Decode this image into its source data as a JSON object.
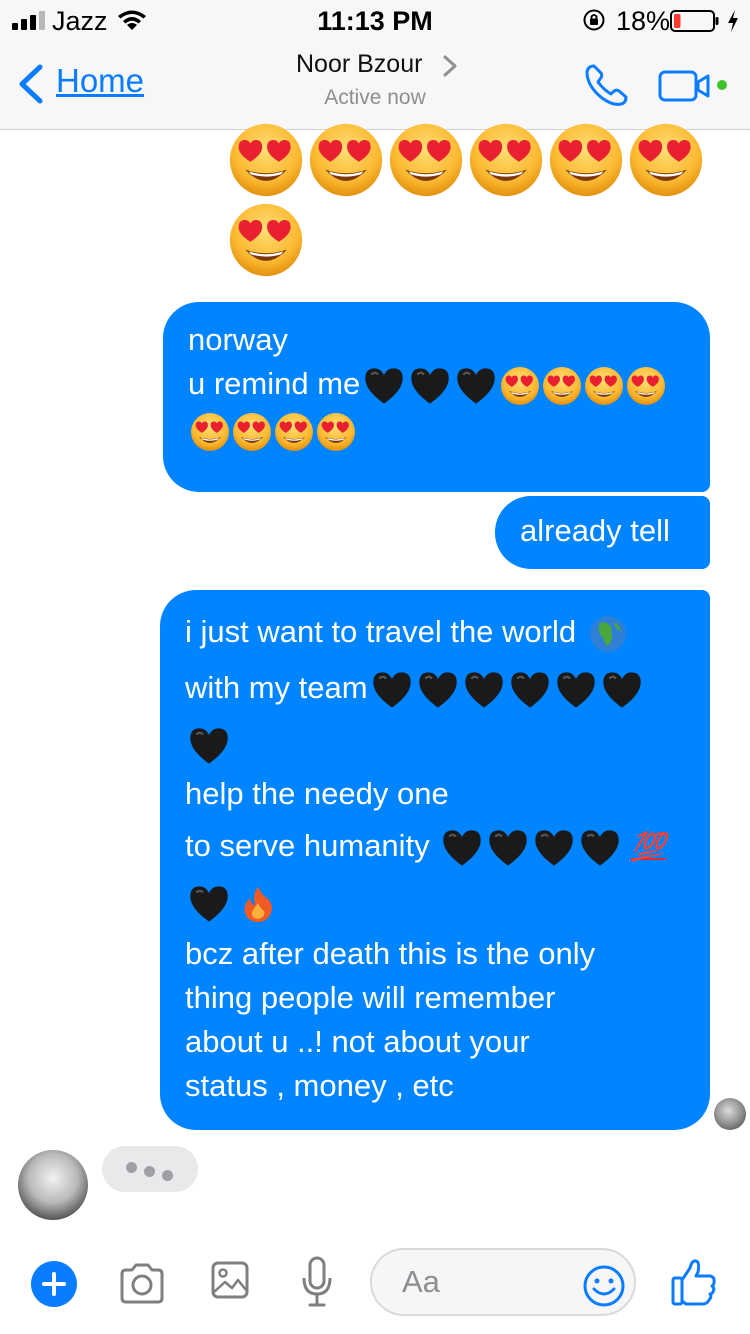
{
  "status_bar": {
    "carrier": "Jazz",
    "time": "11:13 PM",
    "battery_percent": "18%",
    "battery_level": 0.18,
    "icons": [
      "signal-icon",
      "wifi-icon",
      "orientation-lock-icon",
      "battery-icon",
      "charging-bolt-icon"
    ]
  },
  "header": {
    "back_label": "Home",
    "contact_name": "Noor Bzour",
    "contact_status": "Active now",
    "icons": [
      "back-chevron-icon",
      "chevron-right-icon",
      "phone-icon",
      "video-camera-icon"
    ],
    "active_dot_color": "#3ec32b"
  },
  "colors": {
    "accent": "#0a7cff",
    "outgoing_bubble": "#0084ff",
    "typing_bubble": "#e9e9eb"
  },
  "messages": {
    "emoji_only": {
      "emoji": "heart-eyes",
      "count": 7
    },
    "bubble1": {
      "line1": "norway",
      "line2_text": "u remind me"
    },
    "bubble2": {
      "text": "already tell"
    },
    "bubble3": {
      "line1_text": "i just want to travel the world",
      "line2_text": "with my team",
      "line4": "help the needy one",
      "line5_text": "to serve humanity",
      "hundred": "💯",
      "line7": "bcz after death this is the only",
      "line8": "thing people will remember",
      "line9": "about u ..! not about your",
      "line10": "status , money , etc"
    },
    "typing_indicator": true
  },
  "composer": {
    "placeholder": "Aa",
    "icons": [
      "plus-icon",
      "camera-icon",
      "photo-gallery-icon",
      "microphone-icon",
      "emoji-smiley-icon",
      "thumbs-up-icon"
    ]
  }
}
